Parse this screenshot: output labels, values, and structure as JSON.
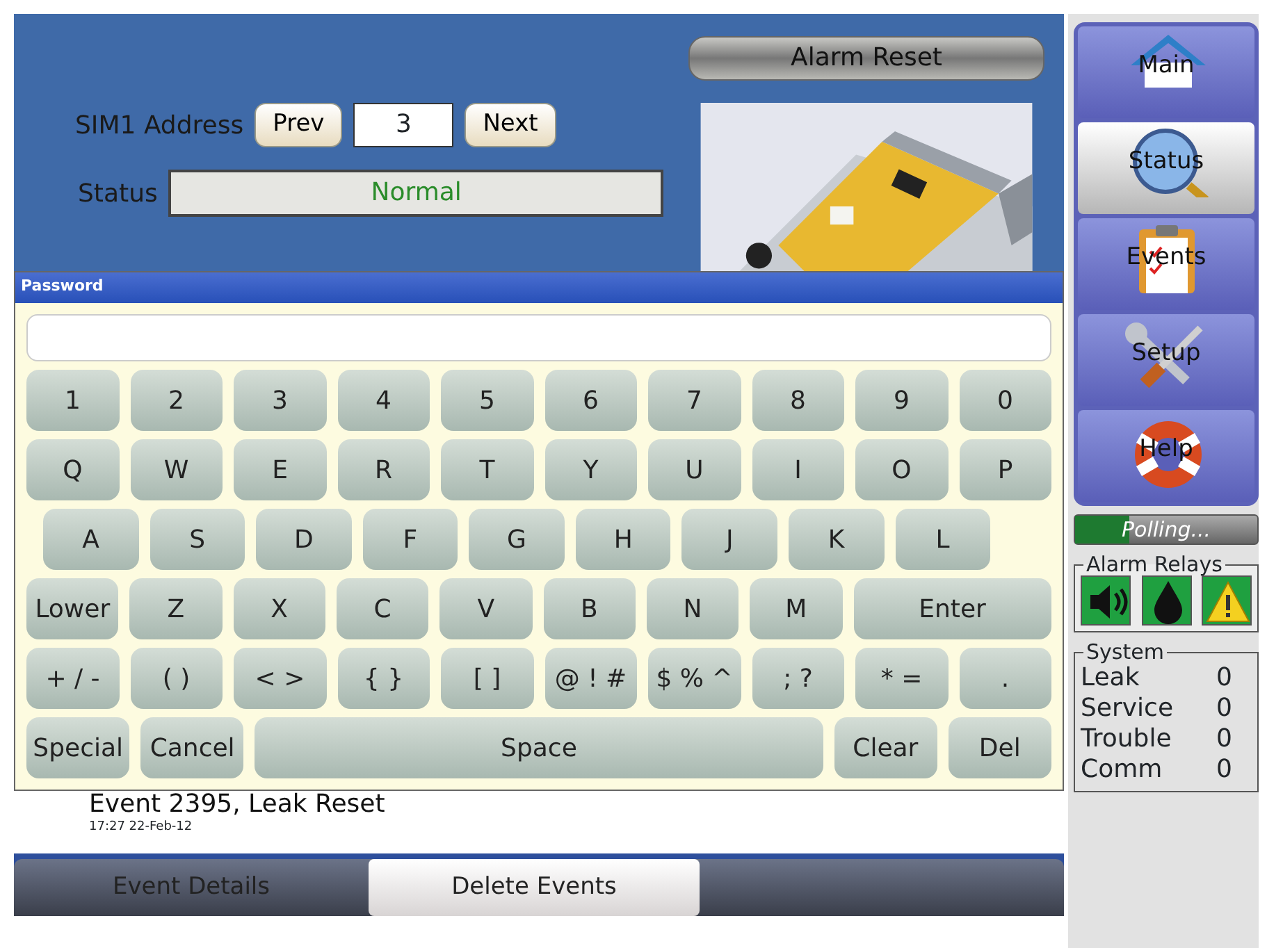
{
  "alarm_reset": "Alarm Reset",
  "address": {
    "label": "SIM1 Address",
    "prev": "Prev",
    "value": "3",
    "next": "Next"
  },
  "status": {
    "label": "Status",
    "value": "Normal"
  },
  "dialog": {
    "title": "Password",
    "keys": [
      [
        {
          "label": "1",
          "kind": "key"
        },
        {
          "label": "2",
          "kind": "key"
        },
        {
          "label": "3",
          "kind": "key"
        },
        {
          "label": "4",
          "kind": "key"
        },
        {
          "label": "5",
          "kind": "key"
        },
        {
          "label": "6",
          "kind": "key"
        },
        {
          "label": "7",
          "kind": "key"
        },
        {
          "label": "8",
          "kind": "key"
        },
        {
          "label": "9",
          "kind": "key"
        },
        {
          "label": "0",
          "kind": "key"
        }
      ],
      [
        {
          "label": "Q",
          "kind": "key"
        },
        {
          "label": "W",
          "kind": "key"
        },
        {
          "label": "E",
          "kind": "key"
        },
        {
          "label": "R",
          "kind": "key"
        },
        {
          "label": "T",
          "kind": "key"
        },
        {
          "label": "Y",
          "kind": "key"
        },
        {
          "label": "U",
          "kind": "key"
        },
        {
          "label": "I",
          "kind": "key"
        },
        {
          "label": "O",
          "kind": "key"
        },
        {
          "label": "P",
          "kind": "key"
        }
      ],
      [
        {
          "label": "A",
          "kind": "key"
        },
        {
          "label": "S",
          "kind": "key"
        },
        {
          "label": "D",
          "kind": "key"
        },
        {
          "label": "F",
          "kind": "key"
        },
        {
          "label": "G",
          "kind": "key"
        },
        {
          "label": "H",
          "kind": "key"
        },
        {
          "label": "J",
          "kind": "key"
        },
        {
          "label": "K",
          "kind": "key"
        },
        {
          "label": "L",
          "kind": "key"
        }
      ],
      [
        {
          "label": "Lower",
          "kind": "key"
        },
        {
          "label": "Z",
          "kind": "key"
        },
        {
          "label": "X",
          "kind": "key"
        },
        {
          "label": "C",
          "kind": "key"
        },
        {
          "label": "V",
          "kind": "key"
        },
        {
          "label": "B",
          "kind": "key"
        },
        {
          "label": "N",
          "kind": "key"
        },
        {
          "label": "M",
          "kind": "key"
        },
        {
          "label": "Enter",
          "kind": "wide"
        }
      ],
      [
        {
          "label": "+ / -",
          "kind": "key"
        },
        {
          "label": "( )",
          "kind": "key"
        },
        {
          "label": "< >",
          "kind": "key"
        },
        {
          "label": "{ }",
          "kind": "key"
        },
        {
          "label": "[ ]",
          "kind": "key"
        },
        {
          "label": "@ ! #",
          "kind": "key"
        },
        {
          "label": "$ % ^",
          "kind": "key"
        },
        {
          "label": "; ?",
          "kind": "key"
        },
        {
          "label": "* =",
          "kind": "key"
        },
        {
          "label": ".",
          "kind": "key"
        }
      ],
      [
        {
          "label": "Special",
          "kind": "key"
        },
        {
          "label": "Cancel",
          "kind": "key"
        },
        {
          "label": "Space",
          "kind": "space"
        },
        {
          "label": "Clear",
          "kind": "key"
        },
        {
          "label": "Del",
          "kind": "key"
        }
      ]
    ]
  },
  "event": {
    "title": "Event 2395, Leak Reset",
    "time": "17:27 22-Feb-12"
  },
  "bottom_tabs": [
    {
      "label": "Event Details",
      "selected": false
    },
    {
      "label": "Delete Events",
      "selected": true
    }
  ],
  "nav": [
    {
      "label": "Main",
      "kind": "home",
      "selected": false
    },
    {
      "label": "Status",
      "kind": "status",
      "selected": true
    },
    {
      "label": "Events",
      "kind": "events",
      "selected": false
    },
    {
      "label": "Setup",
      "kind": "setup",
      "selected": false
    },
    {
      "label": "Help",
      "kind": "help",
      "selected": false
    }
  ],
  "polling": {
    "label": "Polling...",
    "level": 0.3
  },
  "alarm_relays": {
    "title": "Alarm Relays",
    "items": [
      {
        "kind": "horn"
      },
      {
        "kind": "drop"
      },
      {
        "kind": "warning"
      }
    ]
  },
  "system": {
    "title": "System",
    "rows": [
      {
        "name": "Leak",
        "value": "0"
      },
      {
        "name": "Service",
        "value": "0"
      },
      {
        "name": "Trouble",
        "value": "0"
      },
      {
        "name": "Comm",
        "value": "0"
      }
    ]
  }
}
